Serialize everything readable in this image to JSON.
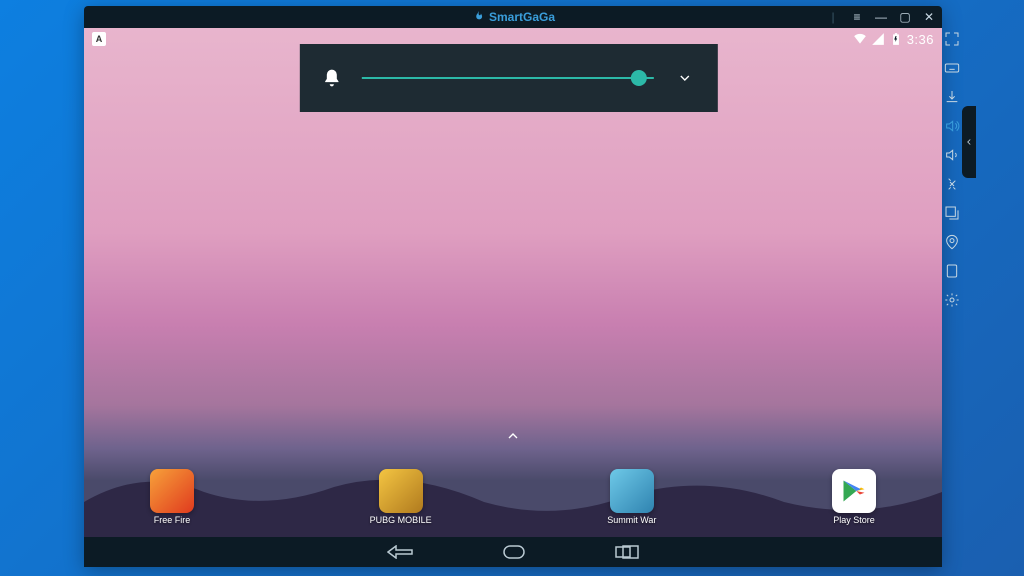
{
  "titlebar": {
    "brand": "SmartGaGa"
  },
  "status": {
    "badge_letter": "A",
    "time": "3:36"
  },
  "volume": {
    "percent": 95
  },
  "apps": [
    {
      "label": "Free Fire",
      "bg": "linear-gradient(135deg,#f7a13a,#e03a1e)"
    },
    {
      "label": "PUBG MOBILE",
      "bg": "linear-gradient(135deg,#f4c542,#b07a1e)"
    },
    {
      "label": "Summit War",
      "bg": "linear-gradient(135deg,#6ec9e8,#2f83b0)"
    },
    {
      "label": "Play Store",
      "bg": "#ffffff"
    }
  ]
}
